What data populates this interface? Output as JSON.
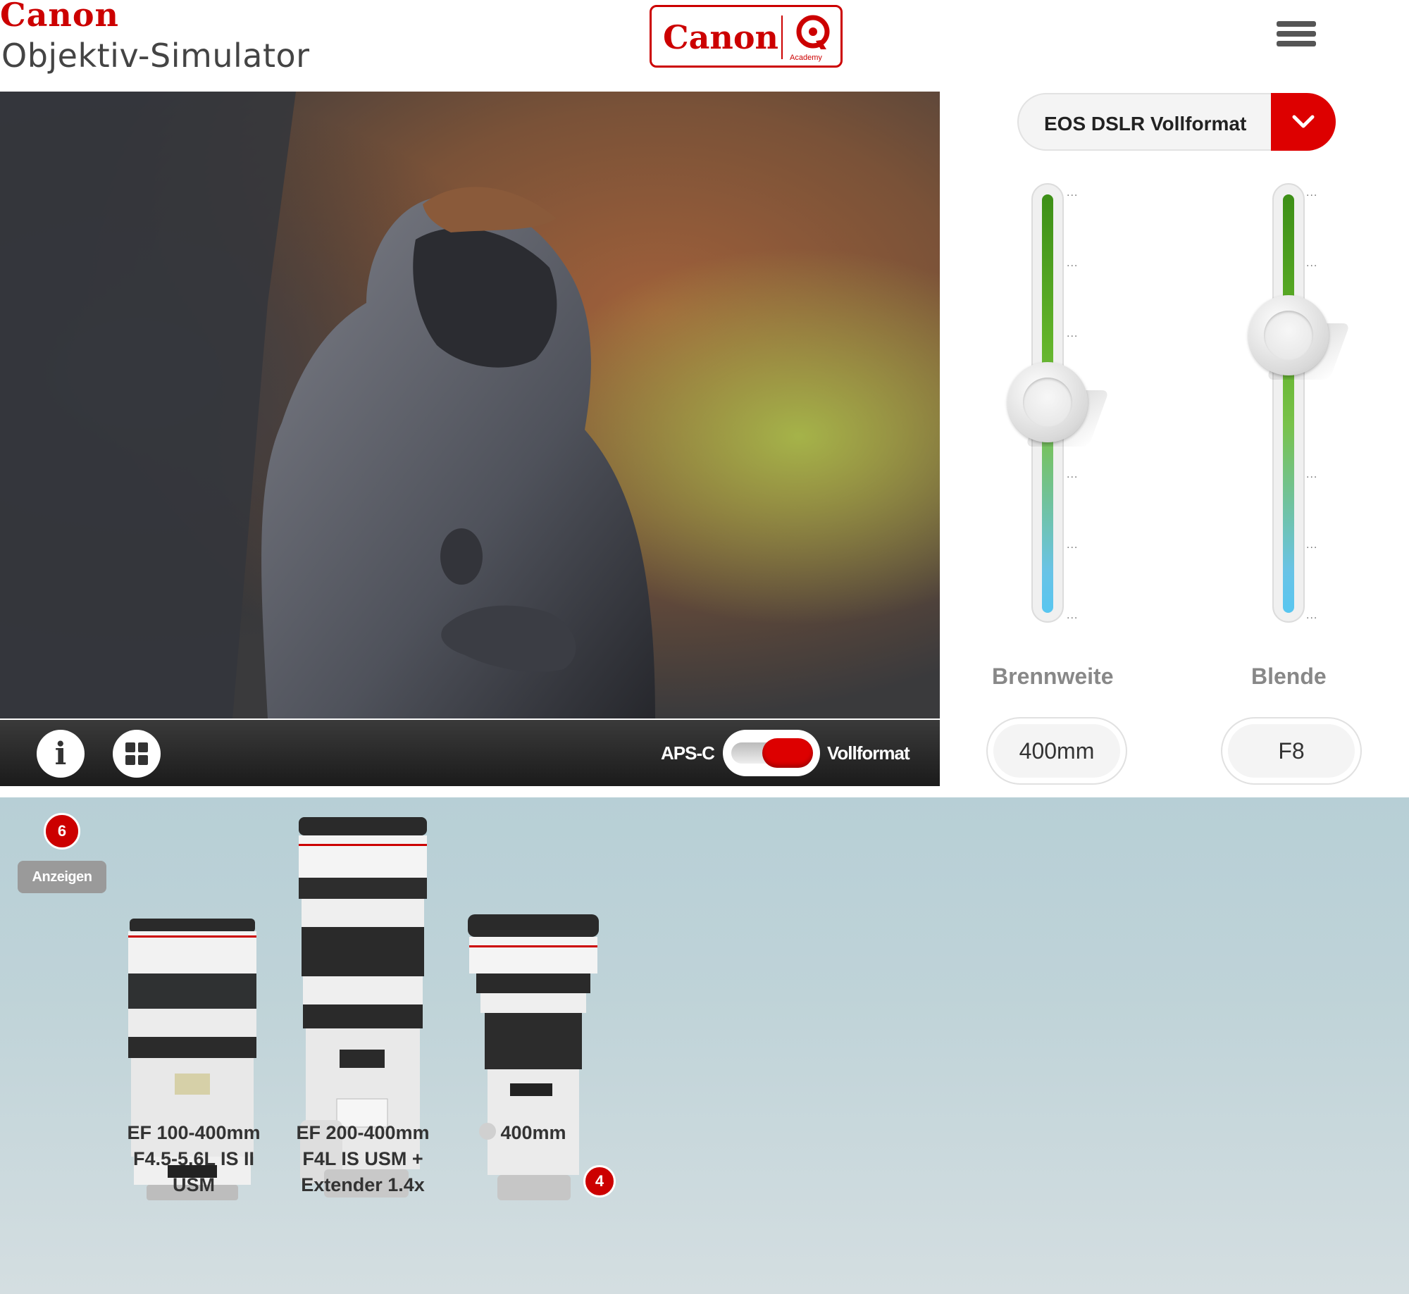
{
  "header": {
    "brand": "Canon",
    "app_title": "Objektiv-Simulator",
    "academy_logo": {
      "word": "Canon",
      "sub": "Academy"
    },
    "menu_icon": "hamburger-menu-icon"
  },
  "photo_bar": {
    "info_icon": "info-icon",
    "grid_icon": "grid-icon",
    "toggle": {
      "left_label": "APS-C",
      "right_label": "Vollformat",
      "selected": "Vollformat"
    }
  },
  "controls": {
    "camera_select": {
      "value": "EOS DSLR Vollformat",
      "icon": "chevron-down-icon"
    },
    "focal_slider": {
      "label": "Brennweite",
      "value": "400mm",
      "level": 0.5
    },
    "aperture_slider": {
      "label": "Blende",
      "value": "F8",
      "level": 0.66
    }
  },
  "lenses": {
    "count": "6",
    "show_button": "Anzeigen",
    "items": [
      {
        "name": "EF 100-400mm F4.5-5.6L IS II USM"
      },
      {
        "name": "EF 200-400mm F4L IS USM + Extender 1.4x"
      },
      {
        "name": "400mm",
        "badge": "4"
      }
    ]
  },
  "colors": {
    "accent": "#cc0000",
    "slider_green": "#62b32a",
    "slider_blue": "#58c6f0"
  }
}
